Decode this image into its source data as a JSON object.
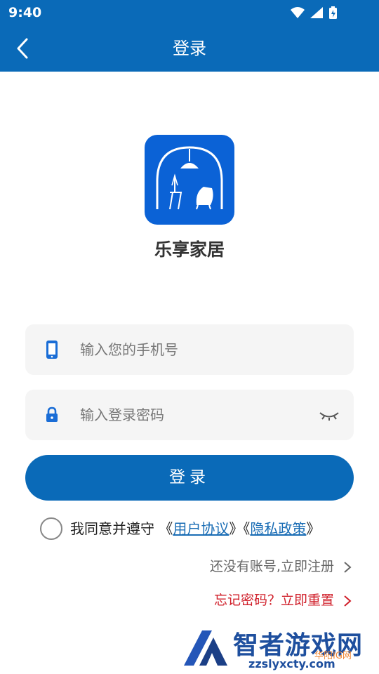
{
  "status_bar": {
    "time": "9:40",
    "icons": [
      "wifi-icon",
      "signal-icon",
      "battery-icon"
    ]
  },
  "app_bar": {
    "title": "登录",
    "back_icon": "chevron-left-icon"
  },
  "brand": {
    "app_name": "乐享家居",
    "logo_icon": "home-furniture-logo-icon"
  },
  "form": {
    "phone_placeholder": "输入您的手机号",
    "password_placeholder": "输入登录密码",
    "phone_icon": "phone-icon",
    "lock_icon": "lock-icon",
    "eye_icon": "eye-closed-icon",
    "login_label": "登录"
  },
  "agreement": {
    "prefix": "我同意并遵守 《",
    "user_agreement": "用户协议",
    "middle": "》《",
    "privacy_policy": "隐私政策",
    "suffix": "》"
  },
  "links": {
    "register": "还没有账号,立即注册",
    "forgot": "忘记密码？立即重置"
  },
  "watermark": {
    "title": "智者游戏网",
    "url": "zzslyxcty.com",
    "sub": "华阳IG网"
  },
  "colors": {
    "primary": "#0A6AB8",
    "logo_bg": "#0B62D6",
    "link": "#1A6DB5",
    "danger": "#D01F2A",
    "field_bg": "#F5F5F5"
  }
}
